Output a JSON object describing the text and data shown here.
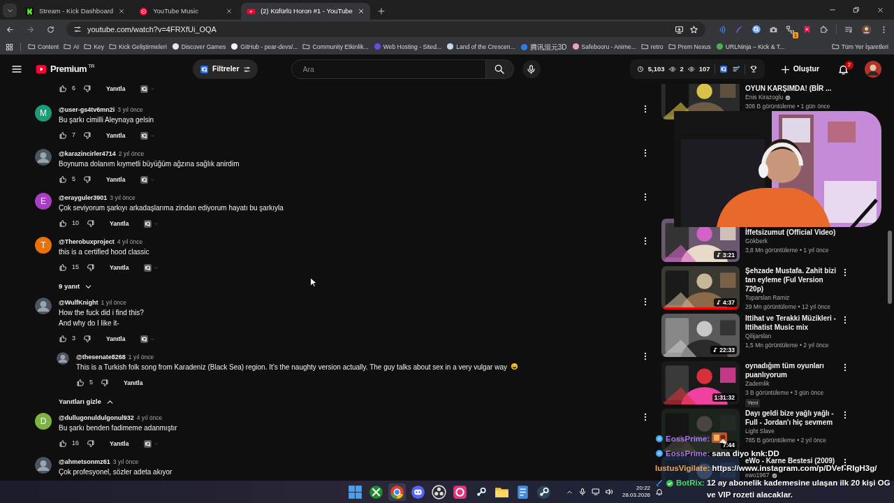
{
  "browser": {
    "tabs": [
      {
        "title": "Stream - Kick Dashboard",
        "kind": "kick",
        "selected": false
      },
      {
        "title": "YouTube Music",
        "kind": "music",
        "selected": false
      },
      {
        "title": "(2) Küfürlü Horon #1 - YouTube",
        "kind": "video",
        "selected": true
      }
    ],
    "url": "youtube.com/watch?v=4FRXfUi_OQA",
    "extension_badge": "1",
    "bookmarks": [
      {
        "label": "Content",
        "kind": "folder"
      },
      {
        "label": "AI",
        "kind": "folder"
      },
      {
        "label": "Key",
        "kind": "folder"
      },
      {
        "label": "Kick Geliştirmeleri",
        "kind": "folder"
      },
      {
        "label": "Discover Games",
        "kind": "site",
        "color": "#e8e8e8"
      },
      {
        "label": "GitHub - pear-devs/...",
        "kind": "site",
        "color": "#f5f5f5"
      },
      {
        "label": "Community Etkinlik...",
        "kind": "folder"
      },
      {
        "label": "Web Hosting - Sited...",
        "kind": "site",
        "color": "#6a4fd6"
      },
      {
        "label": "Land of the Crescen...",
        "kind": "site",
        "color": "#c9d6e8"
      },
      {
        "label": "腾讯混元3D",
        "kind": "site",
        "color": "#2b7de9"
      },
      {
        "label": "Safebooru - Anime...",
        "kind": "site",
        "color": "#eaa2b6"
      },
      {
        "label": "retro",
        "kind": "folder"
      },
      {
        "label": "Prem Nexus",
        "kind": "folder"
      },
      {
        "label": "URLNinja – Kick & T...",
        "kind": "site",
        "color": "#4caf50"
      }
    ],
    "all_bookmarks": "Tüm Yer İşaretleri"
  },
  "header": {
    "logo": "Premium",
    "region": "TR",
    "filter_button": "Filtreler",
    "search": {
      "placeholder": "Ara"
    },
    "stats": [
      "5,103",
      "2",
      "107"
    ],
    "create_button": "Oluştur",
    "notifications": "2"
  },
  "comments": [
    {
      "kind": "tail",
      "likes": "6",
      "reply": "Yanıtla",
      "extension_menu": true
    },
    {
      "kind": "comment",
      "avatar": {
        "kind": "letter",
        "letter": "M",
        "color": "#1f9a78"
      },
      "author": "@user-gs4tv6mn2i",
      "time": "3 yıl önce",
      "text": "Bu şarkı cimilli Aleynaya gelsin",
      "likes": "7",
      "reply": "Yanıtla",
      "extension_menu": true
    },
    {
      "kind": "comment",
      "author": "@karazincirler4714",
      "time": "2 yıl önce",
      "text": "Boynuma dolanım kıymetli büyüğüm ağzına sağlık anirdim",
      "likes": "5",
      "reply": "Yanıtla",
      "extension_menu": true
    },
    {
      "kind": "comment",
      "avatar": {
        "kind": "letter",
        "letter": "E",
        "color": "#a63fc2"
      },
      "author": "@erayguler3901",
      "time": "3 yıl önce",
      "text": "Çok seviyorum şarkıyı arkadaşlarıma zindan ediyorum hayatı bu şarkıyla",
      "likes": "10",
      "reply": "Yanıtla",
      "extension_menu": true
    },
    {
      "kind": "comment",
      "avatar": {
        "kind": "letter",
        "letter": "T",
        "color": "#e8710a"
      },
      "author": "@Therobuxproject",
      "time": "4 yıl önce",
      "text": "this is a certified hood classic",
      "likes": "15",
      "reply": "Yanıtla",
      "extension_menu": true,
      "replies_toggle": {
        "label": "9 yanıt",
        "expanded": false
      }
    },
    {
      "kind": "comment",
      "author": "@WulfKnight",
      "time": "1 yıl önce",
      "text": "How the fuck did i find this?\nAnd why do I like it-",
      "likes": "3",
      "reply": "Yanıtla",
      "extension_menu": true,
      "replies": [
        {
          "kind": "comment",
          "author": "@thesenate8268",
          "time": "1 yıl önce",
          "text": "This is a Turkish folk song from Karadeniz (Black Sea) region. It’s the naughty version actually. The guy talks about sex in a very vulgar way",
          "emoji": true,
          "likes": "5",
          "reply": "Yanıtla",
          "extension_menu": false
        }
      ],
      "replies_toggle": {
        "label": "Yanıtları gizle",
        "expanded": true
      }
    },
    {
      "kind": "comment",
      "avatar": {
        "kind": "letter",
        "letter": "D",
        "color": "#7cb342"
      },
      "author": "@dullugonuldulgonul932",
      "time": "4 yıl önce",
      "text": "Bu şarkı benden fadimeme adanmıştır",
      "likes": "16",
      "reply": "Yanıtla",
      "extension_menu": true
    },
    {
      "kind": "comment",
      "author": "@ahmetsonmz61",
      "time": "3 yıl önce",
      "text": "Çok profesyonel, sözler adeta akıyor"
    }
  ],
  "sidebar": {
    "videos": [
      {
        "title": "OYUN KARŞIMDA! (BİR ...",
        "channel": "Enis Kirazoglu",
        "verified": true,
        "meta": "306 B görüntüleme • 1 gün önce",
        "menu": false
      },
      {
        "title": "İffetsizumut (Official Video)",
        "channel": "Gökberk",
        "verified": false,
        "meta": "3,8 Mn görüntüleme • 1 yıl önce",
        "duration": "3:21",
        "music": true,
        "menu": false
      },
      {
        "title": "Şehzade Mustafa. Zahit bizi tan eyleme (Ful Version 720p)",
        "channel": "Toparslan Ramiz",
        "verified": false,
        "meta": "29 Mn görüntüleme • 12 yıl önce",
        "duration": "4:37",
        "music": true,
        "level": 1,
        "menu": true
      },
      {
        "title": "Ittihat ve Terakki Müzikleri - Ittihatist Music mix",
        "channel": "Qilijarslan",
        "verified": false,
        "meta": "1,5 Mn görüntüleme • 2 yıl önce",
        "duration": "22:33",
        "music": true,
        "menu": true
      },
      {
        "title": "oynadığım tüm oyunları puanlıyorum",
        "channel": "Zademlik",
        "verified": false,
        "meta": "3 B görüntüleme • 3 gün önce",
        "duration": "1:31:32",
        "music": false,
        "badge": "Yeni",
        "menu": true
      },
      {
        "title": "Dayı geldi bize yağlı yağlı - Full - Jordan'ı hiç sevmem",
        "channel": "Light Slave",
        "verified": false,
        "meta": "785 B görüntüleme • 2 yıl önce",
        "duration": "7:44",
        "music": false,
        "menu": true
      },
      {
        "title": "eWo - Karne Bestesi (2009)",
        "channel": "ewo1967",
        "verified": true,
        "menu": true
      }
    ]
  },
  "chat": [
    {
      "kind": "viewer",
      "name": "EossPrime:",
      "color": "#a87be8",
      "emote": true
    },
    {
      "kind": "viewer",
      "name": "EossPrime:",
      "color": "#a87be8",
      "text": "sana diyo knk:DD"
    },
    {
      "kind": "plain",
      "name": "IustusVigilate:",
      "color": "#e8a65a",
      "text": "https://www.instagram.com/p/DVef-RIgH3g/"
    },
    {
      "kind": "bot",
      "name": "BotRix:",
      "color": "#4cd964",
      "text": "12 ay abonelik kademesine ulaşan ilk 20 kişi OG ve VIP rozeti alacaklar."
    }
  ],
  "taskbar": {
    "time": "20:22",
    "date": "28.03.2026"
  }
}
